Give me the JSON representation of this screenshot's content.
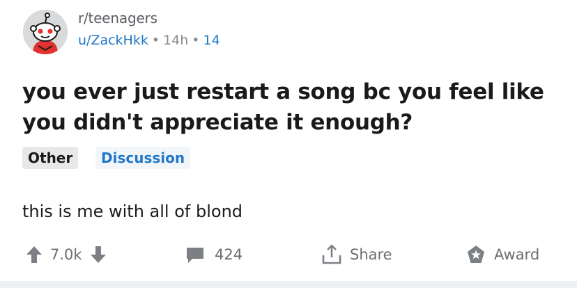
{
  "post": {
    "subreddit": "r/teenagers",
    "username": "u/ZackHkk",
    "separator": "•",
    "time_ago": "14h",
    "score_small": "14",
    "title": "you ever just restart a song bc you feel like you didn't appreciate it enough?",
    "flairs": {
      "other": "Other",
      "discussion": "Discussion"
    },
    "body": "this is me with all of blond"
  },
  "actions": {
    "upvote_icon": "arrow-up-icon",
    "votes": "7.0k",
    "downvote_icon": "arrow-down-icon",
    "comment_icon": "comment-bubble-icon",
    "comments": "424",
    "share_icon": "share-upload-icon",
    "share_label": "Share",
    "award_icon": "award-star-icon",
    "award_label": "Award"
  },
  "colors": {
    "link_blue": "#2077c7",
    "icon_gray": "#7c7f83",
    "text_dark": "#1a1a1b",
    "avatar_red": "#e3322f"
  }
}
